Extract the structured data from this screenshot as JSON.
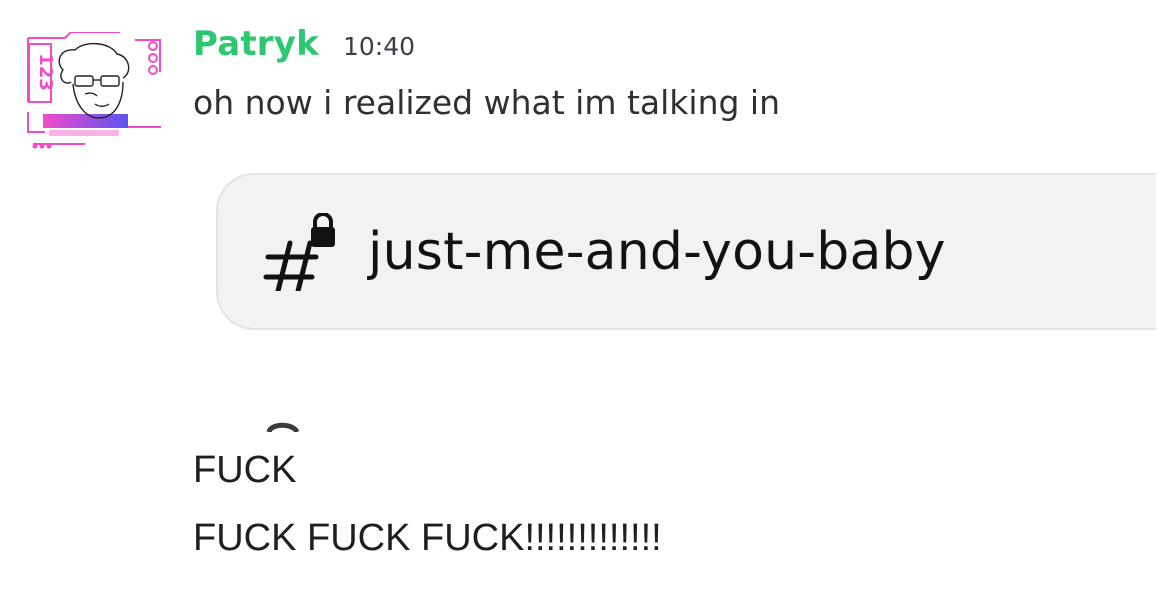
{
  "message": {
    "username": "Patryk",
    "timestamp": "10:40",
    "text": "oh now i realized what im talking in",
    "avatar": {
      "icon": "user-avatar-glasses-face",
      "badge_text": "123",
      "accent_color": "#f04cc8"
    },
    "username_color": "#2dc771"
  },
  "channel_embed": {
    "icon": "locked-text-channel-icon",
    "name": "just-me-and-you-baby",
    "background": "#f2f2f4"
  },
  "followup_messages": [
    "FUCK",
    "FUCK FUCK FUCK!!!!!!!!!!!!!"
  ]
}
